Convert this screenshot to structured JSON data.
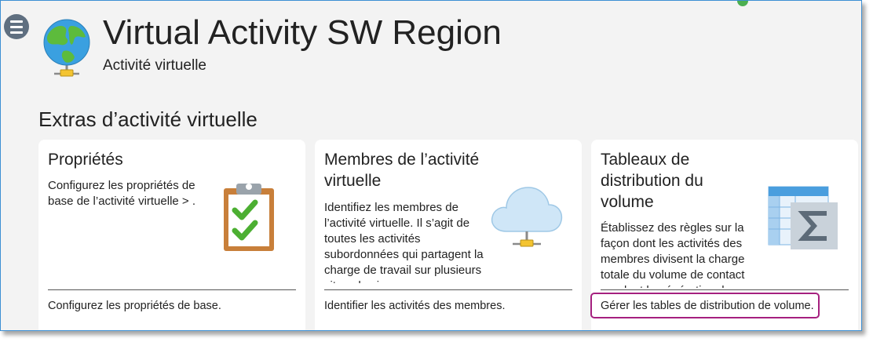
{
  "header": {
    "title": "Virtual Activity SW Region",
    "subtitle": "Activité virtuelle"
  },
  "section": {
    "title": "Extras d’activité virtuelle"
  },
  "cards": [
    {
      "title": "Propriétés",
      "description": "Configurez les propriétés de base de l’activité virtuelle > .",
      "link": "Configurez les propriétés de base.",
      "icon": "clipboard-check-icon"
    },
    {
      "title": "Membres de l’activité virtuelle",
      "description": "Identifiez les membres de l’activité virtuelle. Il s’agit de toutes les activités subordonnées qui partagent la charge de travail sur plusieurs sites physiques.",
      "link": "Identifier les activités des membres.",
      "icon": "cloud-network-icon"
    },
    {
      "title": "Tableaux de distribution du volume",
      "description": "Établissez des règles sur la façon dont les activités des membres divisent la charge totale du volume de contact pendant la génération de prévisions.",
      "link": "Gérer les tables de distribution de volume.",
      "icon": "table-sigma-icon"
    }
  ],
  "colors": {
    "frame_border": "#3c8fd4",
    "highlight": "#a5207f",
    "menu_button": "#5f6f80"
  }
}
